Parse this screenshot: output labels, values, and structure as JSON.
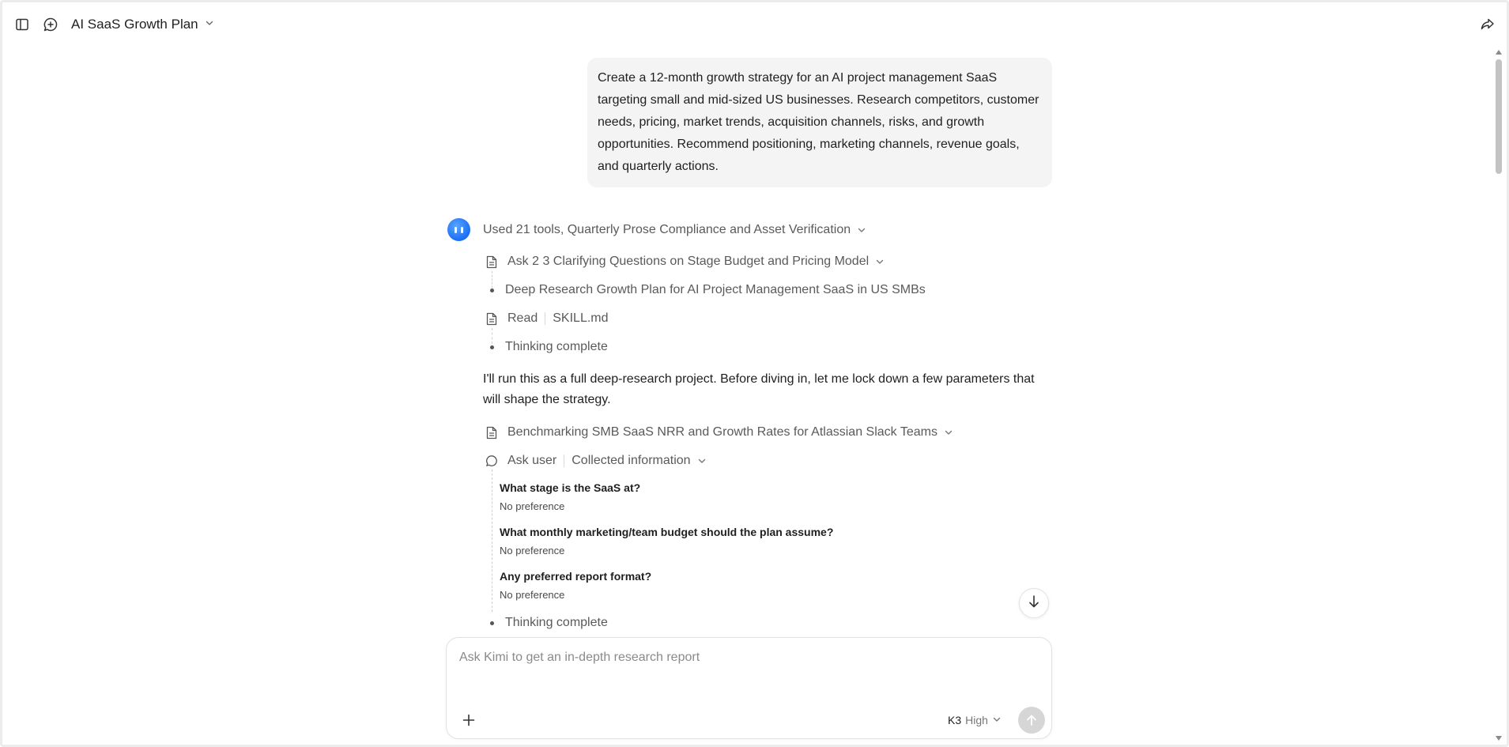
{
  "header": {
    "title": "AI SaaS Growth Plan",
    "sidebar_icon": "sidebar-toggle-icon",
    "new_chat_icon": "new-chat-icon",
    "share_icon": "share-icon"
  },
  "user_message": "Create a 12-month growth strategy for an AI project management SaaS targeting small and mid-sized US businesses. Research competitors, customer needs, pricing, market trends, acquisition channels, risks, and growth opportunities. Recommend positioning, marketing channels, revenue goals, and quarterly actions.",
  "assistant": {
    "summary": "Used 21 tools, Quarterly Prose Compliance and Asset Verification",
    "steps": {
      "clarify": "Ask 2 3 Clarifying Questions on Stage Budget and Pricing Model",
      "deep_research": "Deep Research Growth Plan for AI Project Management SaaS in US SMBs",
      "read_label": "Read",
      "read_file": "SKILL.md",
      "thinking_1": "Thinking complete",
      "benchmark": "Benchmarking SMB SaaS NRR and Growth Rates for Atlassian Slack Teams",
      "ask_user_label": "Ask user",
      "ask_user_status": "Collected information",
      "thinking_2": "Thinking complete"
    },
    "prose": "I'll run this as a full deep-research project. Before diving in, let me lock down a few parameters that will shape the strategy.",
    "questions": [
      {
        "q": "What stage is the SaaS at?",
        "a": "No preference"
      },
      {
        "q": "What monthly marketing/team budget should the plan assume?",
        "a": "No preference"
      },
      {
        "q": "Any preferred report format?",
        "a": "No preference"
      }
    ]
  },
  "composer": {
    "placeholder": "Ask Kimi to get an in-depth research report",
    "model": "K3",
    "level": "High"
  },
  "colors": {
    "accent": "#1a6ef5",
    "bubble": "#f4f4f4",
    "send_disabled": "#d6d6d6"
  }
}
